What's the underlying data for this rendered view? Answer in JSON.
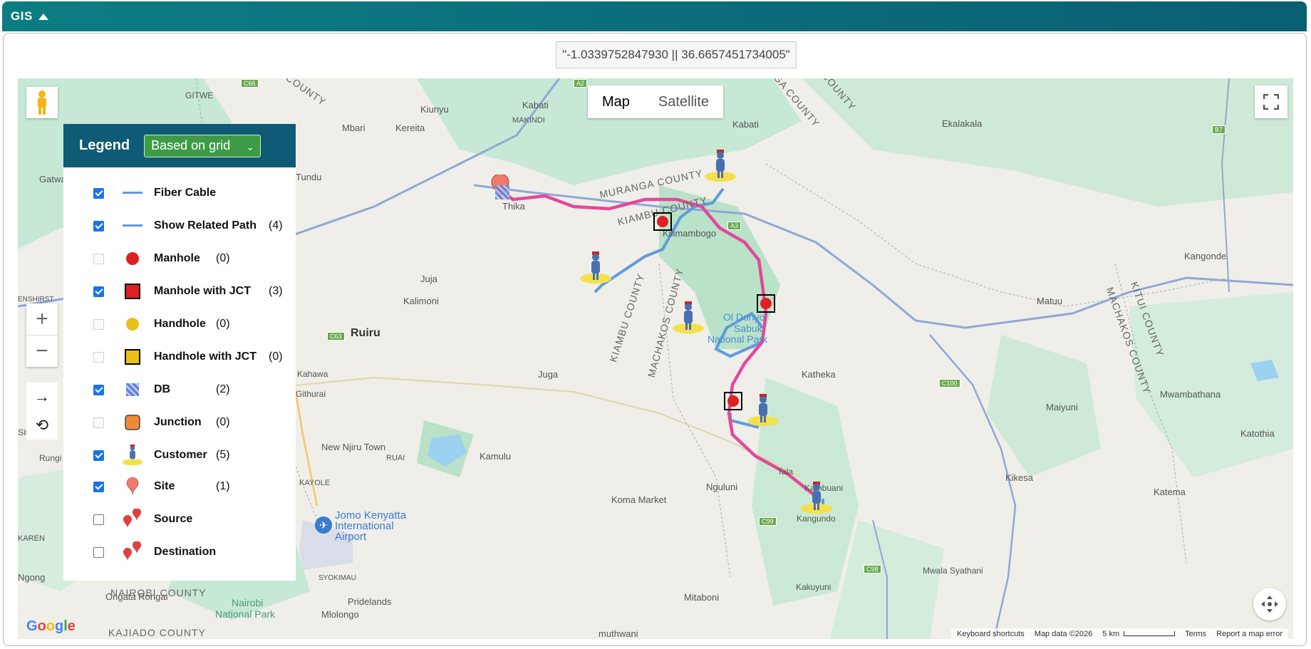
{
  "header": {
    "title": "GIS"
  },
  "coordinates": "\"-1.0339752847930 || 36.6657451734005\"",
  "map_type": {
    "map": "Map",
    "satellite": "Satellite"
  },
  "legend": {
    "title": "Legend",
    "mode": "Based on grid",
    "items": [
      {
        "label": "Fiber Cable",
        "count": "",
        "checked": true
      },
      {
        "label": "Show Related Path",
        "count": "(4)",
        "checked": true
      },
      {
        "label": "Manhole",
        "count": "(0)",
        "checked": false
      },
      {
        "label": "Manhole with JCT",
        "count": "(3)",
        "checked": true
      },
      {
        "label": "Handhole",
        "count": "(0)",
        "checked": false
      },
      {
        "label": "Handhole with JCT",
        "count": "(0)",
        "checked": false
      },
      {
        "label": "DB",
        "count": "(2)",
        "checked": true
      },
      {
        "label": "Junction",
        "count": "(0)",
        "checked": false
      },
      {
        "label": "Customer",
        "count": "(5)",
        "checked": true
      },
      {
        "label": "Site",
        "count": "(1)",
        "checked": true
      },
      {
        "label": "Source",
        "count": "",
        "checked": false
      },
      {
        "label": "Destination",
        "count": "",
        "checked": false
      }
    ]
  },
  "map_labels": {
    "places": [
      "GITWE",
      "Kiunyu",
      "Kabati",
      "MAKINDI",
      "Mbari",
      "Kereita",
      "Kabati",
      "Ekalakala",
      "Gatwa",
      "Tundu",
      "Thika",
      "Kilimambogo",
      "Juja",
      "Kalimoni",
      "Ruiru",
      "Kahawa",
      "Githurai",
      "Juga",
      "Katheka",
      "Matuu",
      "Kangonde",
      "Mwambathana",
      "Maiyuni",
      "Katothia",
      "Kamulu",
      "New Njiru Town",
      "RUAI",
      "KAYOLE",
      "Koma Market",
      "Nguluni",
      "Tala",
      "Kikesa",
      "Katema",
      "Kangundo",
      "Kambuani",
      "Mwala Syathani",
      "Kakuyuni",
      "Mitaboni",
      "Pridelands",
      "Mlolongo",
      "SYOKIMAU",
      "Ngong",
      "Ongata Rongai",
      "muthwani",
      "Sitaru",
      "Rungi",
      "KAREN",
      "ENSHIRST"
    ],
    "counties": [
      "MURANGA COUNTY",
      "KIAMBU COUNTY",
      "KIAMBU COUNTY",
      "MACHAKOS COUNTY",
      "MACHAKOS COUNTY",
      "KITUI COUNTY",
      "NAIROBI COUNTY",
      "KAJIADO COUNTY",
      "COUNTY",
      "ANGA COUNTY",
      "COUNTY"
    ],
    "parks": [
      "Ol Donyo",
      "Sabuk",
      "National Park",
      "Nairobi",
      "National Park"
    ],
    "airport": [
      "Jomo Kenyatta",
      "International",
      "Airport"
    ],
    "roads": [
      "C66",
      "A2",
      "A3",
      "C63",
      "C100",
      "C99",
      "C98",
      "B7"
    ]
  },
  "footer": {
    "keyboard": "Keyboard shortcuts",
    "mapdata": "Map data ©2026",
    "scale": "5 km",
    "terms": "Terms",
    "report": "Report a map error"
  },
  "brand": "Google"
}
